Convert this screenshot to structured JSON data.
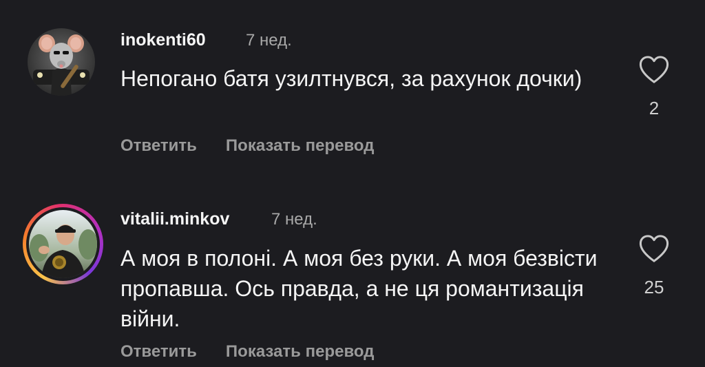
{
  "colors": {
    "background": "#1c1c20",
    "text": "#f5f5f5",
    "muted": "#a8a8a8",
    "action": "#9a9a9a",
    "story_ring": [
      "#f9c34a",
      "#e1306c",
      "#7a38d9"
    ]
  },
  "comments": [
    {
      "username": "inokenti60",
      "time": "7 нед.",
      "text": "Непогано батя узилтнувся, за рахунок дочки)",
      "reply_label": "Ответить",
      "translate_label": "Показать перевод",
      "likes": "2",
      "like_icon": "heart-outline-icon",
      "avatar": "rat-in-suit-avatar"
    },
    {
      "username": "vitalii.minkov",
      "time": "7 нед.",
      "text": "А моя в полоні. А моя без руки. А моя безвісти пропавша. Ось правда, а не ця романтизація війни.",
      "reply_label": "Ответить",
      "translate_label": "Показать перевод",
      "likes": "25",
      "like_icon": "heart-outline-icon",
      "avatar": "man-with-medal-avatar",
      "has_story_ring": true
    }
  ]
}
